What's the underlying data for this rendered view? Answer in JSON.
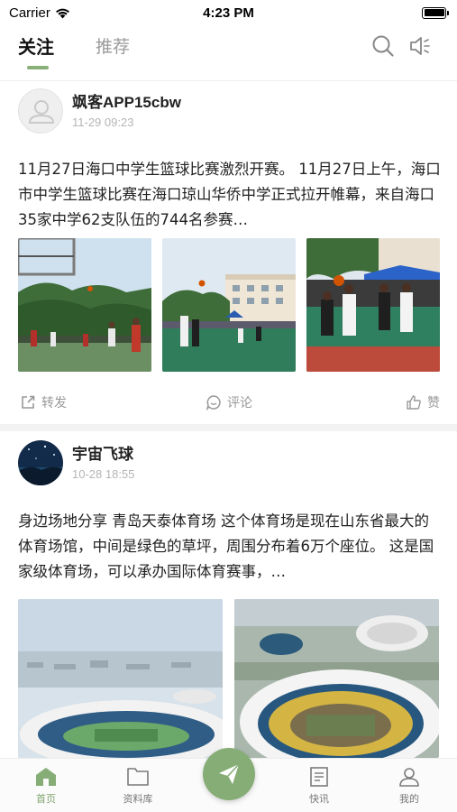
{
  "status_bar": {
    "carrier": "Carrier",
    "time": "4:23 PM"
  },
  "top_nav": {
    "tabs": [
      {
        "label": "关注",
        "active": true
      },
      {
        "label": "推荐",
        "active": false
      }
    ],
    "icons": [
      "search-icon",
      "speaker-icon"
    ],
    "accent_color": "#8ab07a"
  },
  "posts": [
    {
      "author": "飒客APP15cbw",
      "time": "11-29 09:23",
      "text": "11月27日海口中学生篮球比赛激烈开赛。 11月27日上午，海口市中学生篮球比赛在海口琼山华侨中学正式拉开帷幕，来自海口35家中学62支队伍的744名参赛…",
      "images": [
        "basketball-photo-1",
        "basketball-photo-2",
        "basketball-photo-3"
      ],
      "actions": {
        "forward": "转发",
        "comment": "评论",
        "like": "赞"
      }
    },
    {
      "author": "宇宙飞球",
      "time": "10-28 18:55",
      "text": "身边场地分享 青岛天泰体育场 这个体育场是现在山东省最大的体育场馆，中间是绿色的草坪，周围分布着6万个座位。 这是国家级体育场，可以承办国际体育赛事，…",
      "images": [
        "stadium-photo-1",
        "stadium-photo-2"
      ]
    }
  ],
  "tabbar": {
    "items": [
      {
        "label": "首页",
        "icon": "home-icon",
        "active": true
      },
      {
        "label": "资料库",
        "icon": "folder-icon",
        "active": false
      },
      {
        "label": "快讯",
        "icon": "news-icon",
        "active": false
      },
      {
        "label": "我的",
        "icon": "user-icon",
        "active": false
      }
    ],
    "center_button_icon": "paper-plane-icon",
    "accent_color": "#86ad76"
  }
}
